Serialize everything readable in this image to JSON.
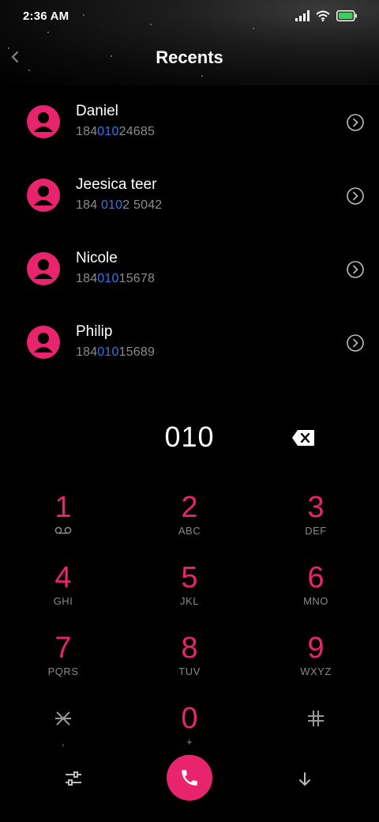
{
  "status": {
    "time": "2:36 AM"
  },
  "header": {
    "title": "Recents"
  },
  "contacts": [
    {
      "name": "Daniel",
      "number_pre": "184",
      "number_hl": "010",
      "number_post": "24685"
    },
    {
      "name": "Jeesica teer",
      "number_pre": "184 ",
      "number_hl": "010",
      "number_post": "2 5042"
    },
    {
      "name": "Nicole",
      "number_pre": "184",
      "number_hl": "010",
      "number_post": "15678"
    },
    {
      "name": "Philip",
      "number_pre": "184",
      "number_hl": "010",
      "number_post": "15689"
    }
  ],
  "dialer": {
    "entered": "010",
    "keys": [
      {
        "digit": "1",
        "letters": ""
      },
      {
        "digit": "2",
        "letters": "ABC"
      },
      {
        "digit": "3",
        "letters": "DEF"
      },
      {
        "digit": "4",
        "letters": "GHI"
      },
      {
        "digit": "5",
        "letters": "JKL"
      },
      {
        "digit": "6",
        "letters": "MNO"
      },
      {
        "digit": "7",
        "letters": "PQRS"
      },
      {
        "digit": "8",
        "letters": "TUV"
      },
      {
        "digit": "9",
        "letters": "WXYZ"
      },
      {
        "digit": "*",
        "letters": ","
      },
      {
        "digit": "0",
        "letters": "+"
      },
      {
        "digit": "#",
        "letters": ""
      }
    ]
  },
  "colors": {
    "accent": "#e8246f",
    "highlight": "#3a73e8",
    "background": "#000000"
  },
  "icons": {
    "back": "chevron-left-icon",
    "detail": "chevron-circle-right-icon",
    "backspace": "backspace-icon",
    "voicemail": "voicemail-icon",
    "call": "phone-icon",
    "settings": "sliders-icon",
    "collapse": "arrow-down-icon"
  }
}
